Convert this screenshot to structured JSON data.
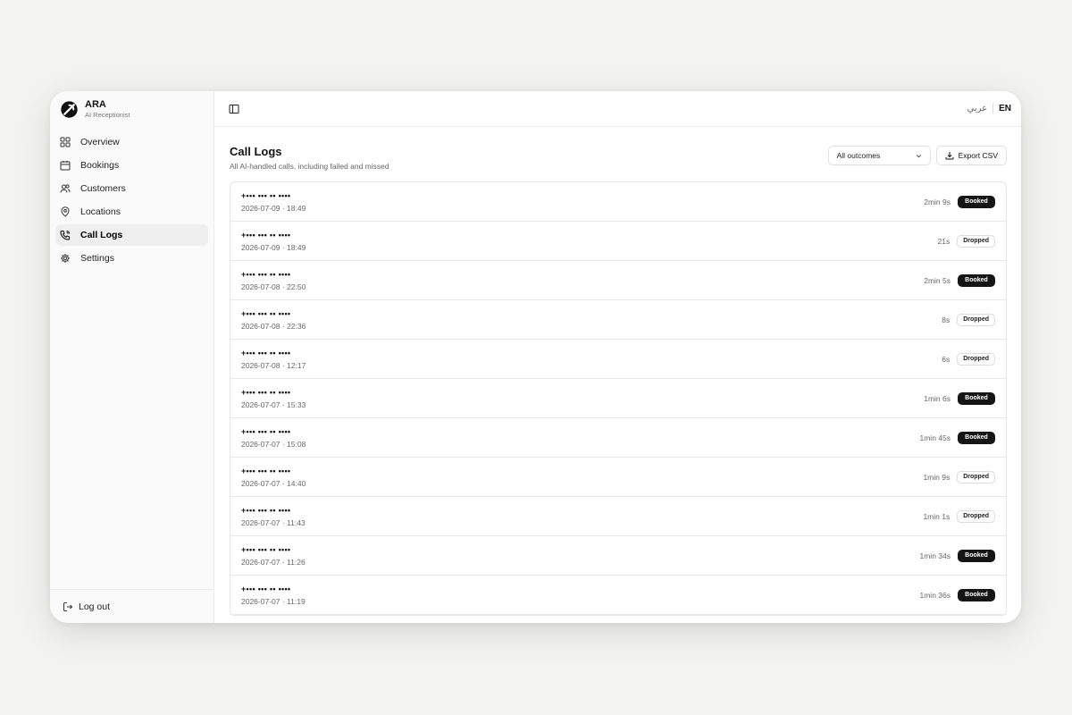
{
  "brand": {
    "name": "ARA",
    "subtitle": "AI Receptionist"
  },
  "sidebar": {
    "items": [
      {
        "label": "Overview",
        "icon": "grid-icon"
      },
      {
        "label": "Bookings",
        "icon": "calendar-icon"
      },
      {
        "label": "Customers",
        "icon": "users-icon"
      },
      {
        "label": "Locations",
        "icon": "map-pin-icon"
      },
      {
        "label": "Call Logs",
        "icon": "phone-icon",
        "active": true
      },
      {
        "label": "Settings",
        "icon": "gear-icon"
      }
    ],
    "logout_label": "Log out"
  },
  "topbar": {
    "lang_ar": "عربي",
    "lang_en": "EN"
  },
  "page": {
    "title": "Call Logs",
    "subtitle": "All AI-handled calls, including failed and missed",
    "filter_value": "All outcomes",
    "export_label": "Export CSV"
  },
  "calls": [
    {
      "phone": "+••• ••• •• ••••",
      "when": "2026-07-09 · 18:49",
      "duration": "2min 9s",
      "outcome": "Booked"
    },
    {
      "phone": "+••• ••• •• ••••",
      "when": "2026-07-09 · 18:49",
      "duration": "21s",
      "outcome": "Dropped"
    },
    {
      "phone": "+••• ••• •• ••••",
      "when": "2026-07-08 · 22:50",
      "duration": "2min 5s",
      "outcome": "Booked"
    },
    {
      "phone": "+••• ••• •• ••••",
      "when": "2026-07-08 · 22:36",
      "duration": "8s",
      "outcome": "Dropped"
    },
    {
      "phone": "+••• ••• •• ••••",
      "when": "2026-07-08 · 12:17",
      "duration": "6s",
      "outcome": "Dropped"
    },
    {
      "phone": "+••• ••• •• ••••",
      "when": "2026-07-07 · 15:33",
      "duration": "1min 6s",
      "outcome": "Booked"
    },
    {
      "phone": "+••• ••• •• ••••",
      "when": "2026-07-07 · 15:08",
      "duration": "1min 45s",
      "outcome": "Booked"
    },
    {
      "phone": "+••• ••• •• ••••",
      "when": "2026-07-07 · 14:40",
      "duration": "1min 9s",
      "outcome": "Dropped"
    },
    {
      "phone": "+••• ••• •• ••••",
      "when": "2026-07-07 · 11:43",
      "duration": "1min 1s",
      "outcome": "Dropped"
    },
    {
      "phone": "+••• ••• •• ••••",
      "when": "2026-07-07 · 11:26",
      "duration": "1min 34s",
      "outcome": "Booked"
    },
    {
      "phone": "+••• ••• •• ••••",
      "when": "2026-07-07 · 11:19",
      "duration": "1min 36s",
      "outcome": "Booked"
    }
  ],
  "colors": {
    "background": "#f3f3ef",
    "booked_badge": "#151515",
    "accent": "#111111"
  }
}
